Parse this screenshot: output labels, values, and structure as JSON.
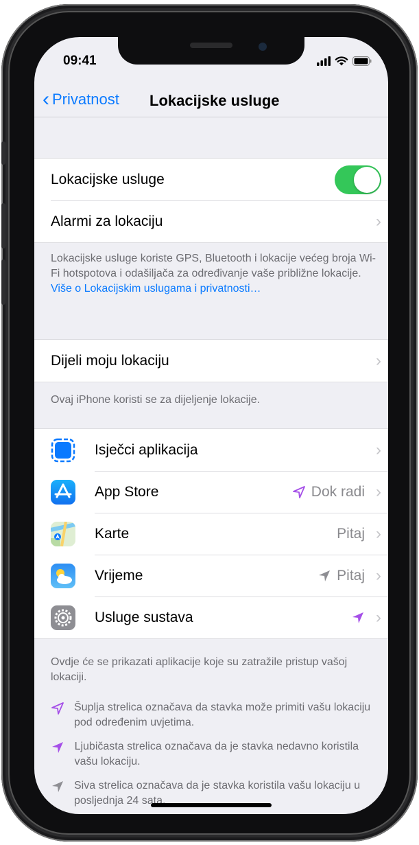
{
  "status_bar": {
    "time": "09:41"
  },
  "nav": {
    "back_label": "Privatnost",
    "title": "Lokacijske usluge"
  },
  "section1": {
    "location_services_label": "Lokacijske usluge",
    "location_services_on": true,
    "alerts_label": "Alarmi za lokaciju"
  },
  "footer1": {
    "text": "Lokacijske usluge koriste GPS, Bluetooth i lokacije većeg broja Wi-Fi hotspotova i odašiljača za određivanje vaše približne lokacije.",
    "link": "Više o Lokacijskim uslugama i privatnosti…"
  },
  "section2": {
    "share_label": "Dijeli moju lokaciju"
  },
  "footer2": {
    "text": "Ovaj iPhone koristi se za dijeljenje lokacije."
  },
  "apps": [
    {
      "label": "Isječci aplikacija",
      "value": "",
      "arrow": "none",
      "icon": "app-clips-icon"
    },
    {
      "label": "App Store",
      "value": "Dok radi",
      "arrow": "hollow-purple",
      "icon": "app-store-icon"
    },
    {
      "label": "Karte",
      "value": "Pitaj",
      "arrow": "none",
      "icon": "maps-icon"
    },
    {
      "label": "Vrijeme",
      "value": "Pitaj",
      "arrow": "gray",
      "icon": "weather-icon"
    },
    {
      "label": "Usluge sustava",
      "value": "",
      "arrow": "solid-purple",
      "icon": "settings-gear-icon"
    }
  ],
  "footer3": {
    "text": "Ovdje će se prikazati aplikacije koje su zatražile pristup vašoj lokaciji."
  },
  "legend": [
    {
      "arrow": "hollow-purple",
      "text": "Šuplja strelica označava da stavka može primiti vašu lokaciju pod određenim uvjetima."
    },
    {
      "arrow": "solid-purple",
      "text": "Ljubičasta strelica označava da je stavka nedavno koristila vašu lokaciju."
    },
    {
      "arrow": "gray",
      "text": "Siva strelica označava da je stavka koristila vašu lokaciju u posljednja 24 sata."
    }
  ],
  "colors": {
    "accent": "#0a7aff",
    "toggle_on": "#34c759",
    "purple_arrow": "#a54fe8",
    "gray_arrow": "#8e8e93"
  }
}
